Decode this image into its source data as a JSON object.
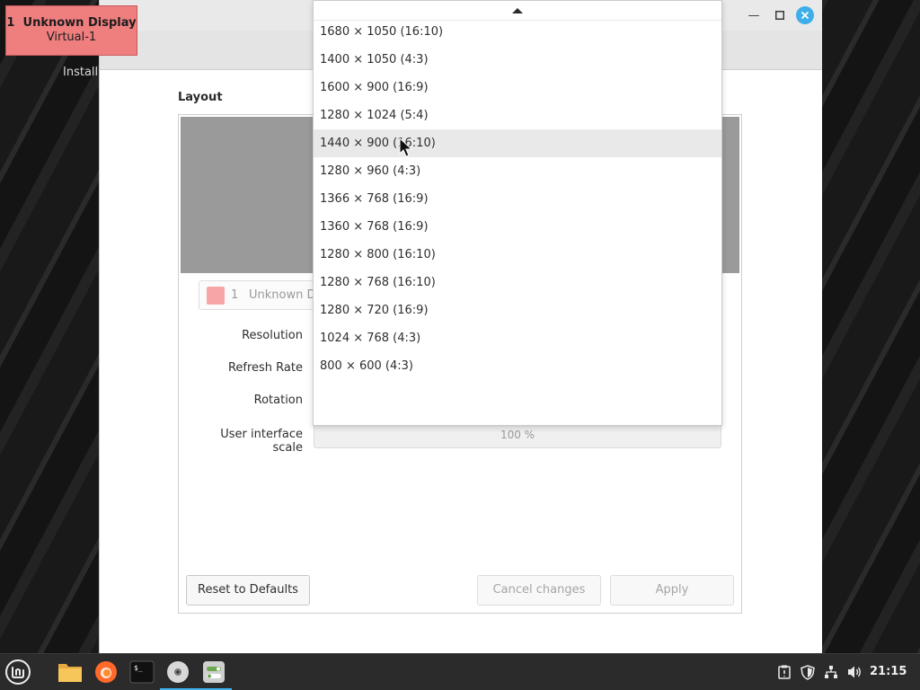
{
  "identifier": {
    "number": "1",
    "display_name": "Unknown Display",
    "connector": "Virtual-1",
    "color": "#ef7e7e"
  },
  "window": {
    "header_partial_label": "Install",
    "section_title": "Layout",
    "controls": [
      "minimize-icon",
      "maximize-icon",
      "close-icon"
    ]
  },
  "display_chip": {
    "number": "1",
    "name": "Unknown D"
  },
  "form": {
    "resolution_label": "Resolution",
    "refresh_rate_label": "Refresh Rate",
    "rotation_label": "Rotation",
    "scale_label": "User interface scale",
    "scale_value": "100 %"
  },
  "resolution_dropdown": {
    "hovered_index": 4,
    "options": [
      "1680 × 1050 (16:10)",
      "1400 × 1050 (4:3)",
      "1600 × 900 (16:9)",
      "1280 × 1024 (5:4)",
      "1440 × 900 (16:10)",
      "1280 × 960 (4:3)",
      "1366 × 768 (16:9)",
      "1360 × 768 (16:9)",
      "1280 × 800 (16:10)",
      "1280 × 768 (16:10)",
      "1280 × 720 (16:9)",
      "1024 × 768 (4:3)",
      "800 × 600 (4:3)"
    ]
  },
  "buttons": {
    "reset": "Reset to Defaults",
    "cancel": "Cancel changes",
    "apply": "Apply"
  },
  "taskbar": {
    "launchers": [
      "mint-menu-icon",
      "files-icon",
      "firefox-icon",
      "terminal-icon",
      "disc-icon",
      "display-settings-icon"
    ],
    "tray": [
      "clipboard-icon",
      "shield-icon",
      "network-icon",
      "volume-icon"
    ],
    "clock": "21:15"
  },
  "colors": {
    "accent": "#3daee9",
    "identifier_bg": "#ef7e7e",
    "chip_swatch": "#f7a6a6"
  }
}
